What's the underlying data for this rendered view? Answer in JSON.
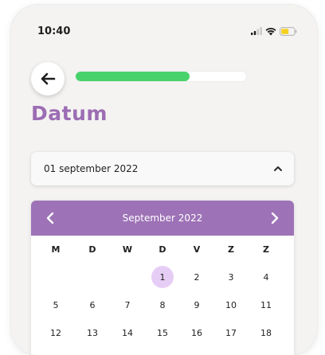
{
  "status_bar": {
    "time": "10:40",
    "icons": [
      "signal-icon",
      "wifi-icon",
      "battery-low-icon"
    ],
    "battery_color": "#f5d020"
  },
  "header": {
    "back_icon": "arrow-left-icon",
    "progress": 0.67,
    "progress_color": "#48d26b"
  },
  "page": {
    "title": "Datum",
    "title_color": "#9c6db3"
  },
  "date_select": {
    "value": "01 september 2022",
    "icon": "chevron-up-icon"
  },
  "calendar": {
    "month_label": "September 2022",
    "header_color": "#9d72b6",
    "selected_color": "#e6cdf6",
    "weekdays": [
      "M",
      "D",
      "W",
      "D",
      "V",
      "Z",
      "Z"
    ],
    "weeks": [
      [
        "",
        "",
        "",
        "1",
        "2",
        "3",
        "4"
      ],
      [
        "5",
        "6",
        "7",
        "8",
        "9",
        "10",
        "11"
      ],
      [
        "12",
        "13",
        "14",
        "15",
        "16",
        "17",
        "18"
      ]
    ],
    "selected_day": "1"
  }
}
